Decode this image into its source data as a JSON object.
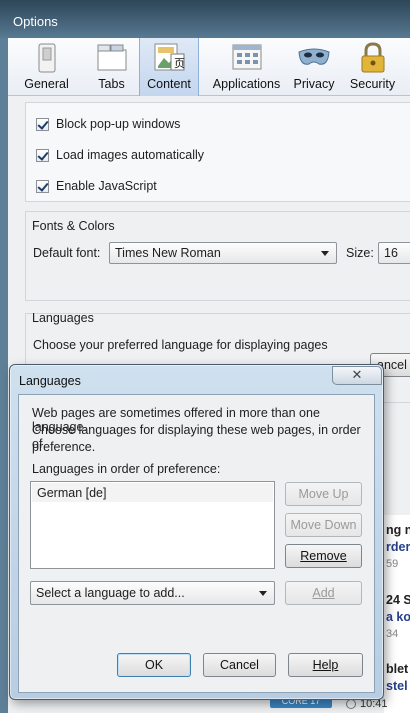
{
  "window": {
    "title": "Options"
  },
  "toolbar": {
    "tabs": [
      {
        "label": "General",
        "icon": "switch-icon"
      },
      {
        "label": "Tabs",
        "icon": "tabs-icon"
      },
      {
        "label": "Content",
        "icon": "content-icon",
        "selected": true
      },
      {
        "label": "Applications",
        "icon": "applications-icon"
      },
      {
        "label": "Privacy",
        "icon": "privacy-mask-icon"
      },
      {
        "label": "Security",
        "icon": "padlock-icon"
      }
    ]
  },
  "content": {
    "checkboxes": [
      {
        "label": "Block pop-up windows",
        "checked": true
      },
      {
        "label": "Load images automatically",
        "checked": true
      },
      {
        "label": "Enable JavaScript",
        "checked": true
      }
    ],
    "fonts": {
      "caption": "Fonts & Colors",
      "default_font_label": "Default font:",
      "default_font_value": "Times New Roman",
      "size_label": "Size:",
      "size_value": "16"
    },
    "languages": {
      "caption": "Languages",
      "description": "Choose your preferred language for displaying pages",
      "cancel_peek": "ancel"
    }
  },
  "background": {
    "fragments": [
      "ng n",
      "rder",
      "59",
      "24 S",
      "a ko",
      "34",
      "blet",
      "stel"
    ],
    "badge": "CORE 17",
    "clock": "10:41"
  },
  "dialog": {
    "title": "Languages",
    "close_glyph": "✕",
    "intro_line1": "Web pages are sometimes offered in more than one language.",
    "intro_line2": "Choose languages for displaying these web pages, in order of",
    "intro_line3": "preference.",
    "list_label": "Languages in order of preference:",
    "languages": [
      "German  [de]"
    ],
    "move_up": "Move Up",
    "move_down": "Move Down",
    "remove": "Remove",
    "select_placeholder": "Select a language to add...",
    "add": "Add",
    "ok": "OK",
    "cancel": "Cancel",
    "help": "Help"
  },
  "colors": {
    "titlebar": "#2d4658",
    "selected_tab": "#c3d6ee",
    "dialog_frame": "#b8cde2"
  }
}
